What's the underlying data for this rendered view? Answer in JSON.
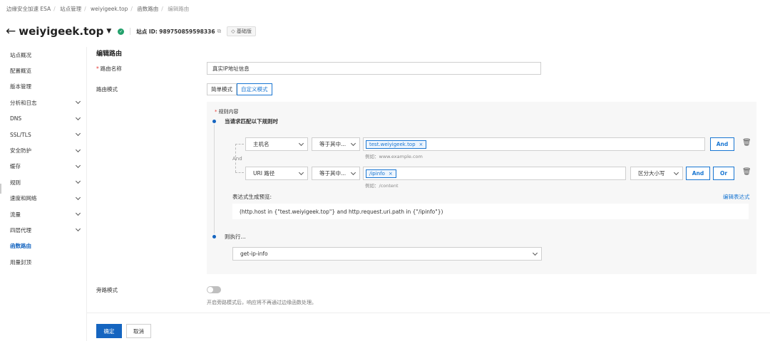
{
  "breadcrumb": [
    "边缘安全加速 ESA",
    "站点管理",
    "weiyigeek.top",
    "函数路由",
    "编辑路由"
  ],
  "header": {
    "back_icon": "arrow-left-icon",
    "site_name": "weiyigeek.top",
    "status_icon": "check-circle-icon",
    "site_id_label": "站点 ID:",
    "site_id": "989750859598336",
    "plan": "基础版"
  },
  "sidebar": {
    "items": [
      {
        "label": "站点概况",
        "expandable": false,
        "active": false
      },
      {
        "label": "配置概览",
        "expandable": false,
        "active": false
      },
      {
        "label": "版本管理",
        "expandable": false,
        "active": false
      },
      {
        "label": "分析和日志",
        "expandable": true,
        "active": false
      },
      {
        "label": "DNS",
        "expandable": true,
        "active": false
      },
      {
        "label": "SSL/TLS",
        "expandable": true,
        "active": false
      },
      {
        "label": "安全防护",
        "expandable": true,
        "active": false
      },
      {
        "label": "缓存",
        "expandable": true,
        "active": false
      },
      {
        "label": "规则",
        "expandable": true,
        "active": false
      },
      {
        "label": "速度和网络",
        "expandable": true,
        "active": false
      },
      {
        "label": "流量",
        "expandable": true,
        "active": false
      },
      {
        "label": "四层代理",
        "expandable": true,
        "active": false
      },
      {
        "label": "函数路由",
        "expandable": false,
        "active": true
      },
      {
        "label": "用量封顶",
        "expandable": false,
        "active": false
      }
    ]
  },
  "form": {
    "section_title": "编辑路由",
    "route_name_label": "路由名称",
    "route_name_value": "真实IP地址信息",
    "route_mode_label": "路由模式",
    "mode_simple": "简单模式",
    "mode_custom": "自定义模式",
    "rule_content_label": "规则内容",
    "match_label": "当请求匹配以下规则时",
    "and_label": "And",
    "conditions": [
      {
        "field": "主机名",
        "operator": "等于其中...",
        "tag": "test.weiyigeek.top",
        "hint": "例如：www.example.com",
        "and": "And"
      },
      {
        "field": "URI 路径",
        "operator": "等于其中...",
        "tag": "/ipinfo",
        "hint": "例如：/content",
        "case": "区分大小写",
        "and": "And",
        "or": "Or"
      }
    ],
    "expr_label": "表达式生成预览:",
    "expr_edit": "编辑表达式",
    "expression": "(http.host in {\"test.weiyigeek.top\"} and http.request.uri.path in {\"/ipinfo\"})",
    "then_label": "则执行...",
    "function_value": "get-ip-info",
    "bypass_label": "旁路模式",
    "bypass_on": false,
    "bypass_desc": "开启旁路模式后，响应将不再通过边缘函数处理。",
    "confirm": "确定",
    "cancel": "取消"
  },
  "colors": {
    "accent": "#1976d2",
    "primary": "#1565c0",
    "success": "#22a06b"
  }
}
